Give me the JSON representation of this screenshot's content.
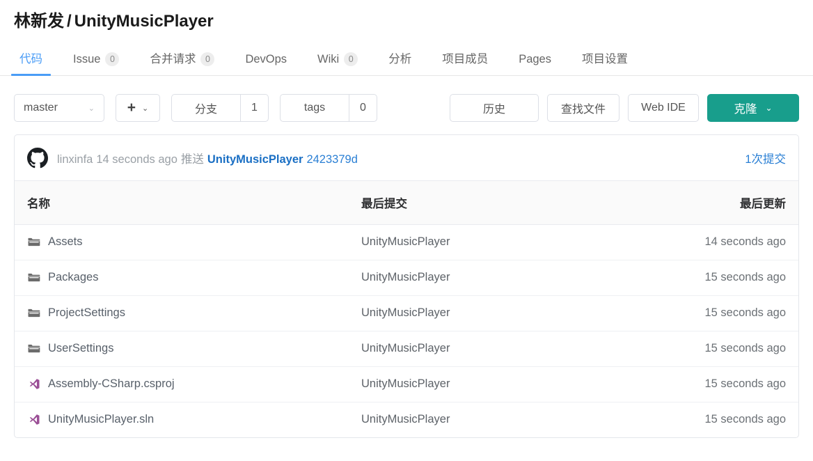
{
  "header": {
    "owner": "林新发",
    "separator": "/",
    "repo": "UnityMusicPlayer"
  },
  "tabs": [
    {
      "label": "代码",
      "badge": null,
      "active": true
    },
    {
      "label": "Issue",
      "badge": "0",
      "active": false
    },
    {
      "label": "合并请求",
      "badge": "0",
      "active": false
    },
    {
      "label": "DevOps",
      "badge": null,
      "active": false
    },
    {
      "label": "Wiki",
      "badge": "0",
      "active": false
    },
    {
      "label": "分析",
      "badge": null,
      "active": false
    },
    {
      "label": "项目成员",
      "badge": null,
      "active": false
    },
    {
      "label": "Pages",
      "badge": null,
      "active": false
    },
    {
      "label": "项目设置",
      "badge": null,
      "active": false
    }
  ],
  "toolbar": {
    "branch": "master",
    "branch_caret": "⌄",
    "add_plus": "+",
    "add_caret": "⌄",
    "branches_label": "分支",
    "branches_count": "1",
    "tags_label": "tags",
    "tags_count": "0",
    "history_label": "历史",
    "find_file_label": "查找文件",
    "web_ide_label": "Web IDE",
    "clone_label": "克隆",
    "clone_caret": "⌄"
  },
  "commit_bar": {
    "avatar_icon": "github-octocat-icon",
    "author": "linxinfa",
    "when": "14 seconds ago",
    "verb": "推送",
    "message": "UnityMusicPlayer",
    "hash": "2423379d",
    "commit_count": "1次提交"
  },
  "table": {
    "columns": [
      "名称",
      "最后提交",
      "最后更新"
    ],
    "rows": [
      {
        "icon": "folder-icon",
        "name": "Assets",
        "commit": "UnityMusicPlayer",
        "updated": "14 seconds ago"
      },
      {
        "icon": "folder-icon",
        "name": "Packages",
        "commit": "UnityMusicPlayer",
        "updated": "15 seconds ago"
      },
      {
        "icon": "folder-icon",
        "name": "ProjectSettings",
        "commit": "UnityMusicPlayer",
        "updated": "15 seconds ago"
      },
      {
        "icon": "folder-icon",
        "name": "UserSettings",
        "commit": "UnityMusicPlayer",
        "updated": "15 seconds ago"
      },
      {
        "icon": "visual-studio-icon",
        "name": "Assembly-CSharp.csproj",
        "commit": "UnityMusicPlayer",
        "updated": "15 seconds ago"
      },
      {
        "icon": "visual-studio-icon",
        "name": "UnityMusicPlayer.sln",
        "commit": "UnityMusicPlayer",
        "updated": "15 seconds ago"
      }
    ]
  },
  "colors": {
    "accent_blue": "#4a9cf6",
    "link_blue": "#2a7fd4",
    "primary_green": "#189e8c",
    "folder_gray": "#6b6b6b",
    "vs_purple": "#9b4f96",
    "border": "#e4e6eb",
    "header_bg": "#fafafa"
  }
}
